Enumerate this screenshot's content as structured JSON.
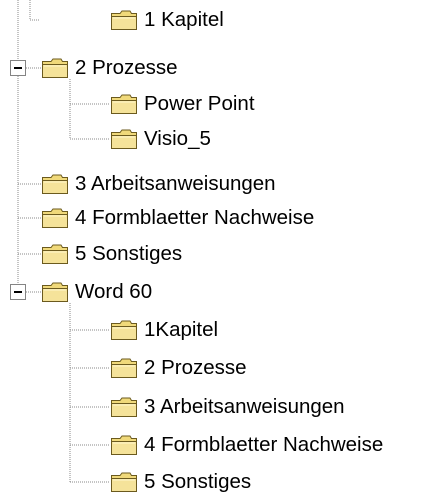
{
  "tree": {
    "nodes": [
      {
        "label": "1 Kapitel",
        "level": 1,
        "expandable": false
      },
      {
        "label": "2 Prozesse",
        "level": 0,
        "expandable": true,
        "expanded": true
      },
      {
        "label": "Power Point",
        "level": 1,
        "expandable": false
      },
      {
        "label": "Visio_5",
        "level": 1,
        "expandable": false
      },
      {
        "label": "3 Arbeitsanweisungen",
        "level": 0,
        "expandable": false
      },
      {
        "label": "4 Formblaetter Nachweise",
        "level": 0,
        "expandable": false
      },
      {
        "label": "5 Sonstiges",
        "level": 0,
        "expandable": false
      },
      {
        "label": "Word 60",
        "level": 0,
        "expandable": true,
        "expanded": true
      },
      {
        "label": "1Kapitel",
        "level": 1,
        "expandable": false
      },
      {
        "label": "2 Prozesse",
        "level": 1,
        "expandable": false
      },
      {
        "label": "3 Arbeitsanweisungen",
        "level": 1,
        "expandable": false
      },
      {
        "label": "4 Formblaetter Nachweise",
        "level": 1,
        "expandable": false
      },
      {
        "label": "5 Sonstiges",
        "level": 1,
        "expandable": false
      }
    ]
  },
  "colors": {
    "folder_fill": "#f5e39a",
    "folder_tab": "#f0d97a",
    "folder_outline": "#6b5a1e",
    "connector": "#8a8a8a",
    "expander_border": "#848484"
  },
  "icons": {
    "folder": "folder-icon",
    "expander": "minus-box-icon"
  }
}
